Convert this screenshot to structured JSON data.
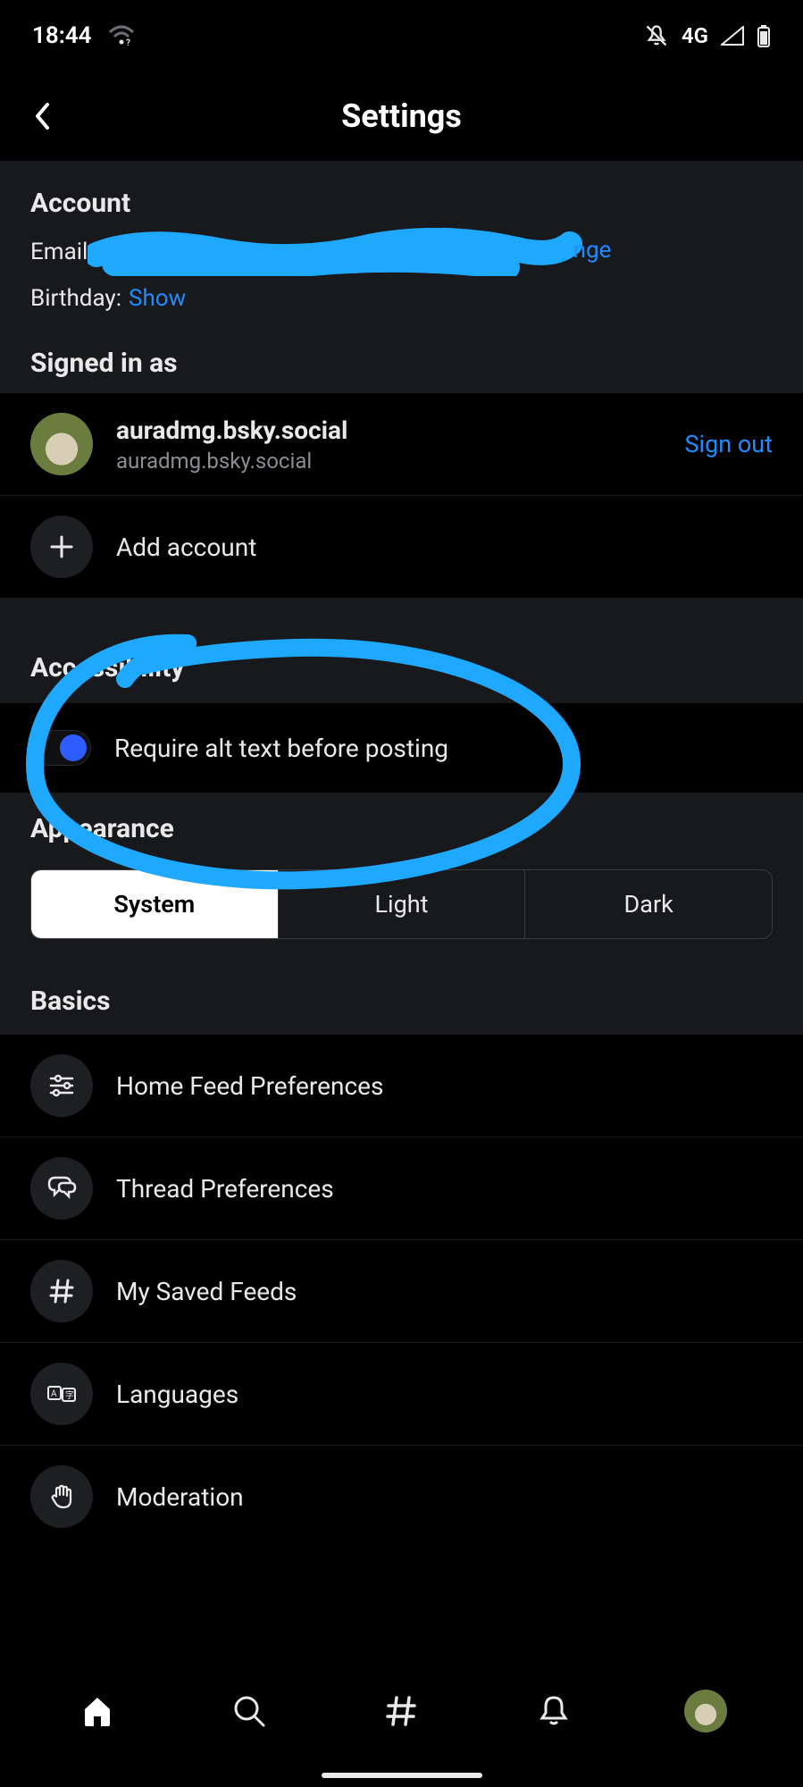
{
  "status": {
    "time": "18:44",
    "network": "4G"
  },
  "header": {
    "title": "Settings"
  },
  "account": {
    "section_title": "Account",
    "email_label": "Email",
    "email_change_peek": "nge",
    "birthday_label": "Birthday:",
    "birthday_action": "Show"
  },
  "signed_in": {
    "section_title": "Signed in as",
    "display_name": "auradmg.bsky.social",
    "handle": "auradmg.bsky.social",
    "sign_out": "Sign out",
    "add_account": "Add account"
  },
  "accessibility": {
    "section_title": "Accessibility",
    "alt_text_label": "Require alt text before posting",
    "alt_text_enabled": true
  },
  "appearance": {
    "section_title": "Appearance",
    "options": [
      "System",
      "Light",
      "Dark"
    ],
    "selected_index": 0
  },
  "basics": {
    "section_title": "Basics",
    "items": [
      {
        "icon": "sliders-icon",
        "label": "Home Feed Preferences"
      },
      {
        "icon": "chat-icon",
        "label": "Thread Preferences"
      },
      {
        "icon": "hash-icon",
        "label": "My Saved Feeds"
      },
      {
        "icon": "translate-icon",
        "label": "Languages"
      },
      {
        "icon": "hand-icon",
        "label": "Moderation"
      }
    ]
  },
  "annotation": {
    "stroke_color": "#1ea9ff"
  }
}
